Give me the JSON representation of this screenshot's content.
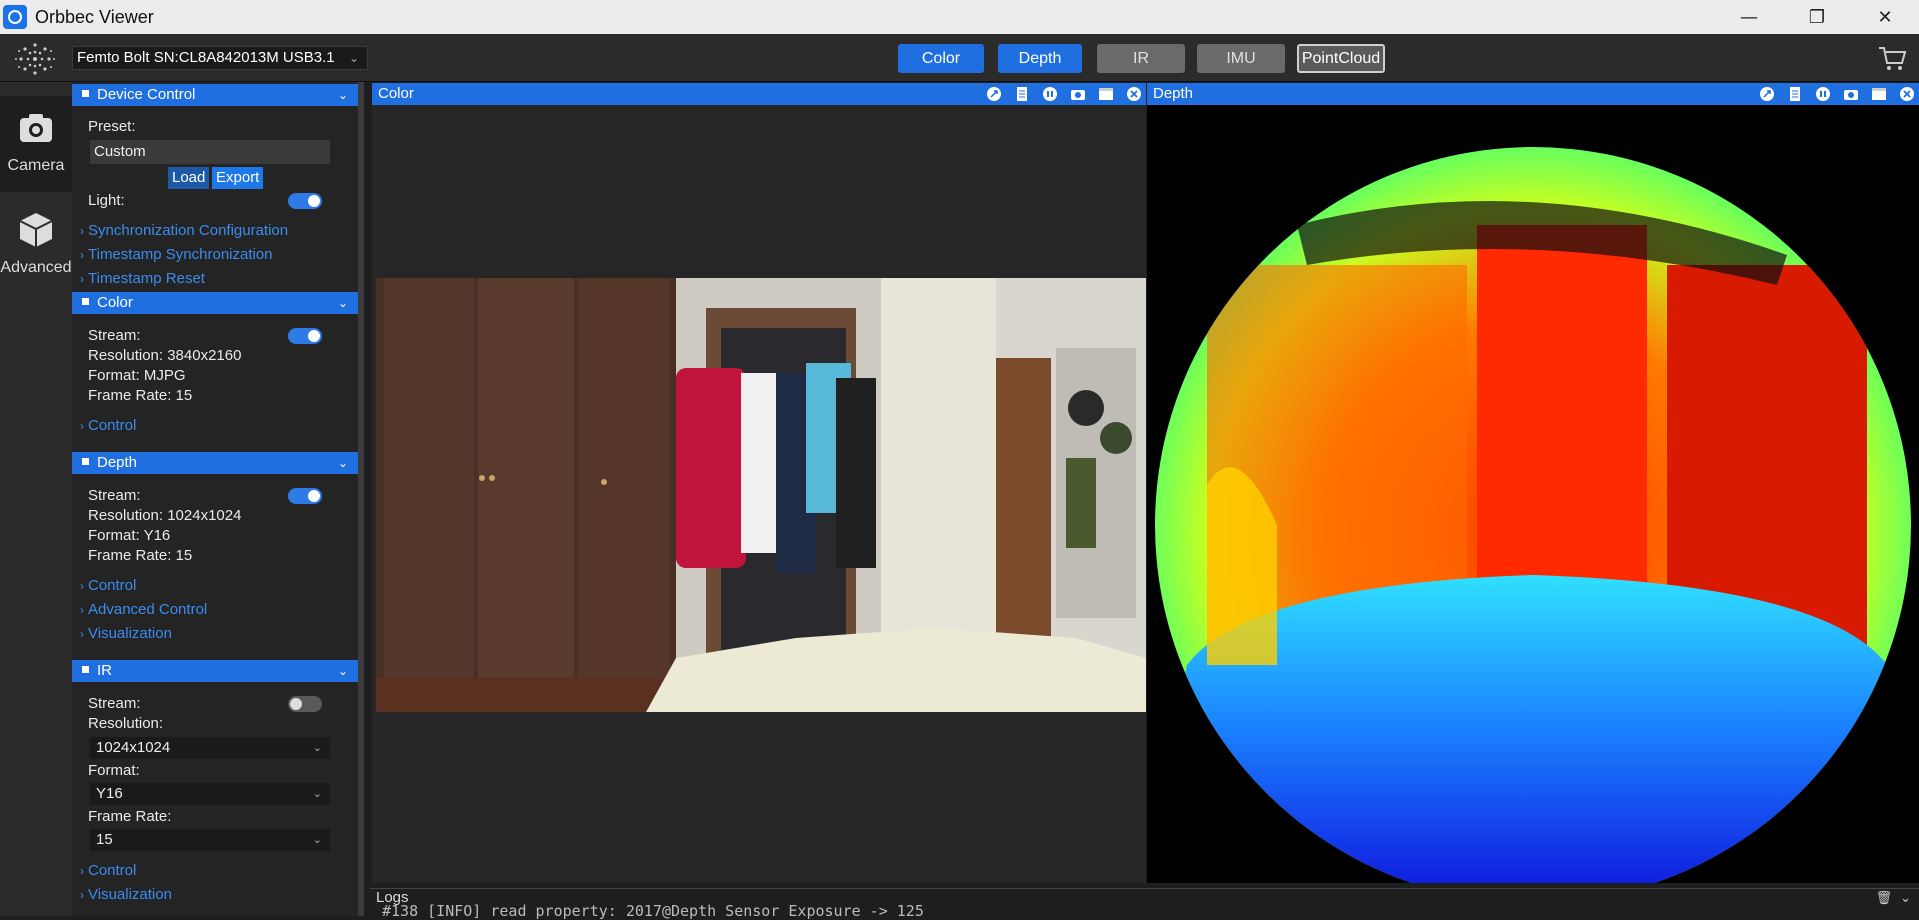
{
  "window": {
    "title": "Orbbec Viewer",
    "app_icon": "orbbec-icon"
  },
  "toolbar": {
    "device": "Femto Bolt SN:CL8A842013M USB3.1",
    "streams": [
      {
        "label": "Color",
        "state": "on"
      },
      {
        "label": "Depth",
        "state": "on"
      },
      {
        "label": "IR",
        "state": "off"
      },
      {
        "label": "IMU",
        "state": "off"
      },
      {
        "label": "PointCloud",
        "state": "outline"
      }
    ]
  },
  "nav": [
    {
      "label": "Camera",
      "icon": "camera-icon",
      "active": true
    },
    {
      "label": "Advanced",
      "icon": "cube-icon",
      "active": false
    }
  ],
  "device_control": {
    "title": "Device Control",
    "preset_label": "Preset:",
    "preset_value": "Custom",
    "load": "Load",
    "export": "Export",
    "light_label": "Light:",
    "light_on": true,
    "links": [
      "Synchronization Configuration",
      "Timestamp Synchronization",
      "Timestamp Reset"
    ]
  },
  "color_section": {
    "title": "Color",
    "stream_label": "Stream:",
    "stream_on": true,
    "resolution": "Resolution: 3840x2160",
    "format": "Format: MJPG",
    "frame_rate": "Frame Rate: 15",
    "links": [
      "Control"
    ]
  },
  "depth_section": {
    "title": "Depth",
    "stream_label": "Stream:",
    "stream_on": true,
    "resolution": "Resolution: 1024x1024",
    "format": "Format: Y16",
    "frame_rate": "Frame Rate: 15",
    "links": [
      "Control",
      "Advanced Control",
      "Visualization"
    ]
  },
  "ir_section": {
    "title": "IR",
    "stream_label": "Stream:",
    "stream_on": false,
    "resolution_label": "Resolution:",
    "resolution_value": "1024x1024",
    "format_label": "Format:",
    "format_value": "Y16",
    "frame_rate_label": "Frame Rate:",
    "frame_rate_value": "15",
    "links": [
      "Control",
      "Visualization"
    ]
  },
  "views": {
    "color": {
      "title": "Color"
    },
    "depth": {
      "title": "Depth"
    }
  },
  "logs": {
    "title": "Logs",
    "line": "#138 [INFO] read property: 2017@Depth Sensor Exposure -> 125"
  },
  "colors": {
    "accent": "#1f6fe0",
    "link": "#3a8cf0",
    "toolbar_bg": "#2b2b2b"
  }
}
